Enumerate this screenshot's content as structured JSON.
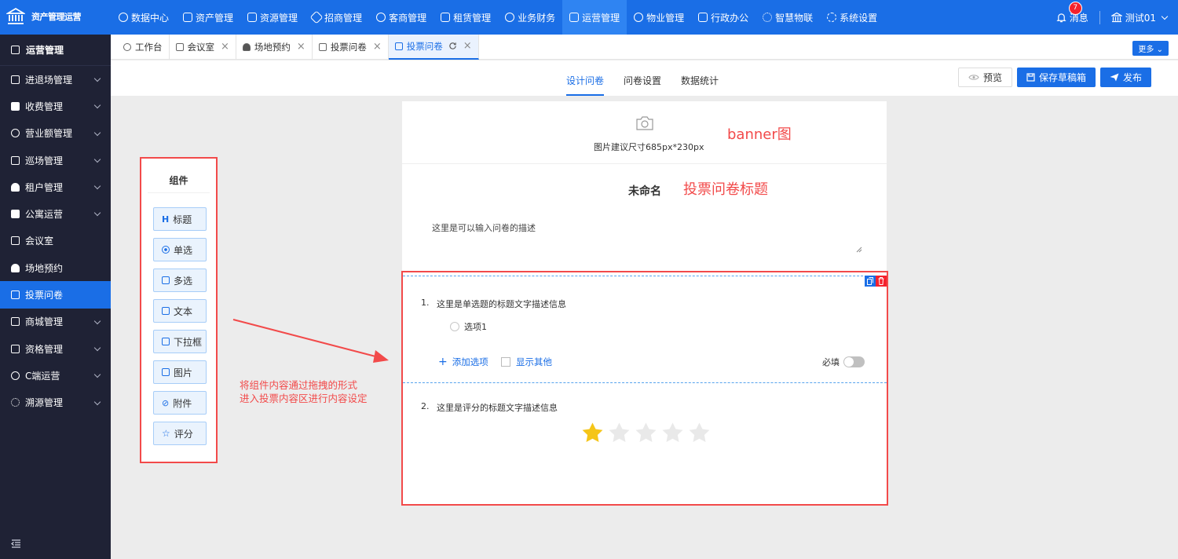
{
  "app": {
    "title": "资产管理运营"
  },
  "topnav": [
    {
      "label": "数据中心",
      "icon": "dashboard-icon"
    },
    {
      "label": "资产管理",
      "icon": "cube-icon"
    },
    {
      "label": "资源管理",
      "icon": "building-icon"
    },
    {
      "label": "招商管理",
      "icon": "tag-icon"
    },
    {
      "label": "客商管理",
      "icon": "users-icon"
    },
    {
      "label": "租赁管理",
      "icon": "house-icon"
    },
    {
      "label": "业务财务",
      "icon": "coin-icon"
    },
    {
      "label": "运营管理",
      "icon": "operation-icon",
      "active": true
    },
    {
      "label": "物业管理",
      "icon": "home-icon"
    },
    {
      "label": "行政办公",
      "icon": "monitor-icon"
    },
    {
      "label": "智慧物联",
      "icon": "iot-icon"
    },
    {
      "label": "系统设置",
      "icon": "gear-icon"
    }
  ],
  "header": {
    "messages_label": "消息",
    "message_count": "7",
    "user_name": "测试01"
  },
  "sidebar": {
    "title": "运营管理",
    "items": [
      {
        "label": "进退场管理",
        "has_children": true
      },
      {
        "label": "收费管理",
        "has_children": true
      },
      {
        "label": "营业额管理",
        "has_children": true
      },
      {
        "label": "巡场管理",
        "has_children": true
      },
      {
        "label": "租户管理",
        "has_children": true
      },
      {
        "label": "公寓运营",
        "has_children": true
      },
      {
        "label": "会议室",
        "has_children": false
      },
      {
        "label": "场地预约",
        "has_children": false
      },
      {
        "label": "投票问卷",
        "has_children": false,
        "active": true
      },
      {
        "label": "商城管理",
        "has_children": true
      },
      {
        "label": "资格管理",
        "has_children": true
      },
      {
        "label": "C端运营",
        "has_children": true
      },
      {
        "label": "溯源管理",
        "has_children": true
      }
    ]
  },
  "tabs": [
    {
      "label": "工作台",
      "closable": false
    },
    {
      "label": "会议室",
      "closable": true
    },
    {
      "label": "场地预约",
      "closable": true
    },
    {
      "label": "投票问卷",
      "closable": true
    },
    {
      "label": "投票问卷",
      "closable": true,
      "active": true
    }
  ],
  "more_label": "更多",
  "design_tabs": [
    {
      "label": "设计问卷",
      "active": true
    },
    {
      "label": "问卷设置"
    },
    {
      "label": "数据统计"
    }
  ],
  "actions": {
    "preview": "预览",
    "save_draft": "保存草稿箱",
    "publish": "发布"
  },
  "components": {
    "title": "组件",
    "items": [
      "标题",
      "单选",
      "多选",
      "文本",
      "下拉框",
      "图片",
      "附件",
      "评分"
    ]
  },
  "annotations": {
    "drag_line1": "将组件内容通过拖拽的形式",
    "drag_line2": "进入投票内容区进行内容设定",
    "banner": "banner图",
    "title": "投票问卷标题"
  },
  "form": {
    "banner_hint": "图片建议尺寸685px*230px",
    "title": "未命名",
    "description": "这里是可以输入问卷的描述",
    "questions": [
      {
        "number": "1.",
        "text": "这里是单选题的标题文字描述信息",
        "options": [
          "选项1"
        ],
        "add_option": "添加选项",
        "show_other": "显示其他",
        "required_label": "必填"
      },
      {
        "number": "2.",
        "text": "这里是评分的标题文字描述信息",
        "rating": 1,
        "rating_max": 5
      }
    ]
  },
  "colors": {
    "primary": "#1a6ee6",
    "sidebar": "#1f2235",
    "annotation": "#f24a4a",
    "star": "#f5c518"
  }
}
